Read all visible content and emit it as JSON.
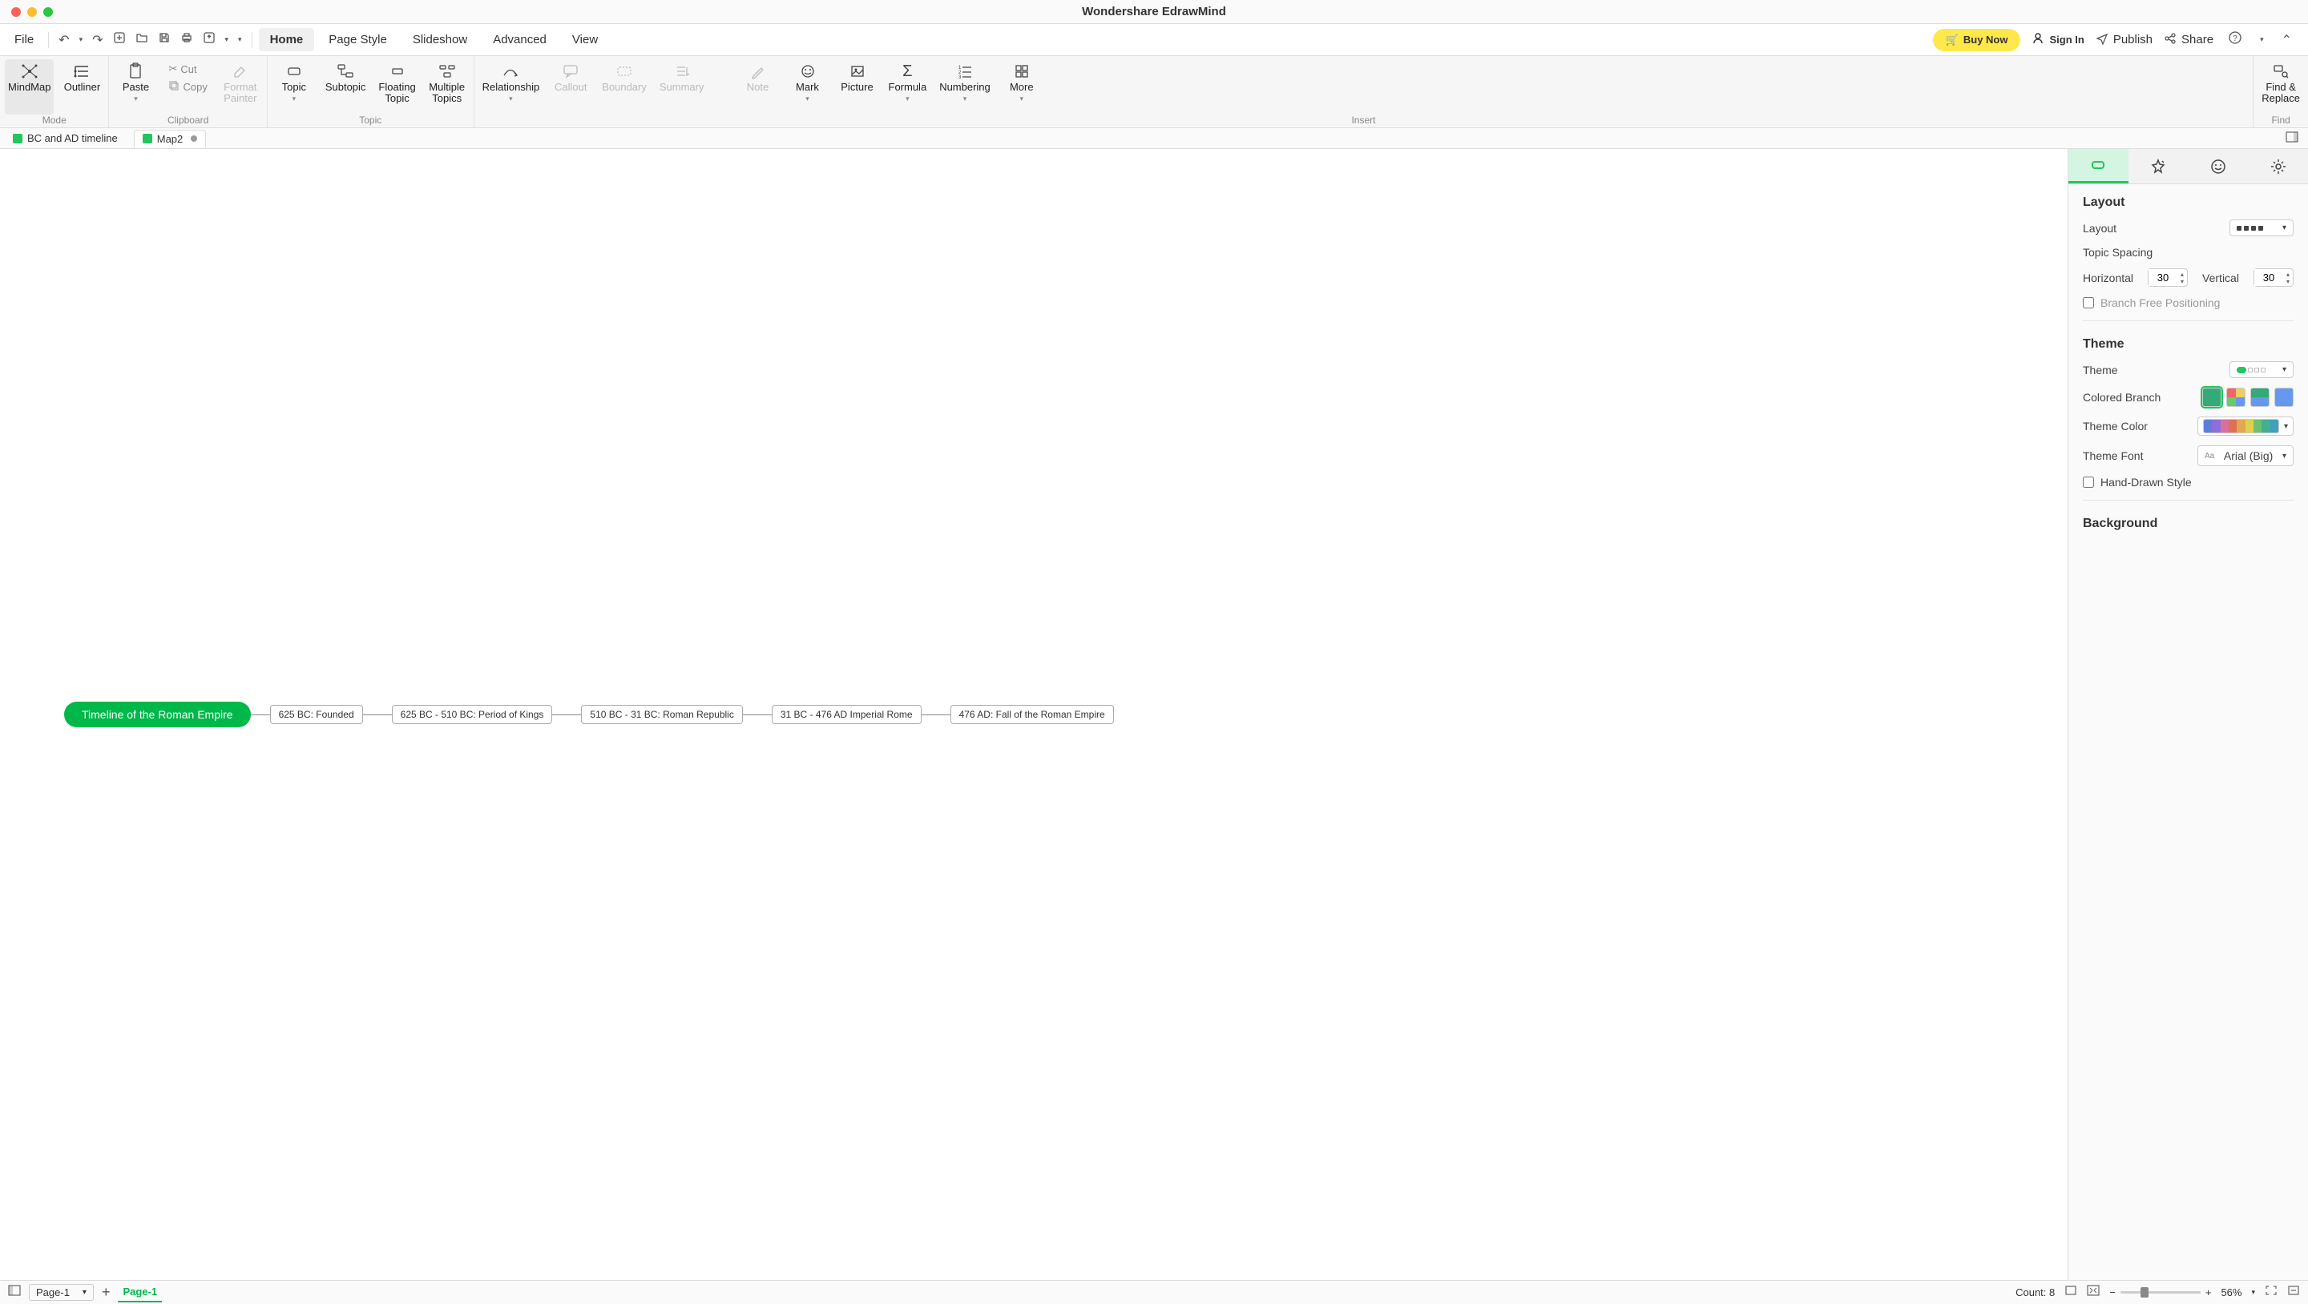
{
  "titlebar": {
    "title": "Wondershare EdrawMind"
  },
  "menubar": {
    "file": "File",
    "tabs": [
      "Home",
      "Page Style",
      "Slideshow",
      "Advanced",
      "View"
    ],
    "active_tab": 0,
    "buy_now": "Buy Now",
    "sign_in": "Sign In",
    "publish": "Publish",
    "share": "Share"
  },
  "ribbon": {
    "mode": {
      "mindmap": "MindMap",
      "outliner": "Outliner",
      "label": "Mode"
    },
    "clipboard": {
      "paste": "Paste",
      "cut": "Cut",
      "copy": "Copy",
      "format_painter": "Format\nPainter",
      "label": "Clipboard"
    },
    "topic": {
      "topic": "Topic",
      "subtopic": "Subtopic",
      "floating": "Floating\nTopic",
      "multiple": "Multiple\nTopics",
      "label": "Topic"
    },
    "insert": {
      "relationship": "Relationship",
      "callout": "Callout",
      "boundary": "Boundary",
      "summary": "Summary",
      "note": "Note",
      "mark": "Mark",
      "picture": "Picture",
      "formula": "Formula",
      "numbering": "Numbering",
      "more": "More",
      "label": "Insert"
    },
    "find": {
      "find_replace": "Find &\nReplace",
      "label": "Find"
    }
  },
  "doc_tabs": {
    "tabs": [
      {
        "label": "BC and AD timeline",
        "active": false,
        "dirty": false
      },
      {
        "label": "Map2",
        "active": true,
        "dirty": true
      }
    ]
  },
  "timeline": {
    "root": "Timeline of the Roman Empire",
    "nodes": [
      "625 BC: Founded",
      "625 BC - 510 BC: Period of Kings",
      "510 BC - 31 BC: Roman Republic",
      "31 BC - 476 AD Imperial Rome",
      "476 AD: Fall of the Roman Empire"
    ]
  },
  "sidebar": {
    "layout": {
      "title": "Layout",
      "layout_label": "Layout",
      "spacing_label": "Topic Spacing",
      "horizontal_label": "Horizontal",
      "horizontal_value": "30",
      "vertical_label": "Vertical",
      "vertical_value": "30",
      "branch_free": "Branch Free Positioning"
    },
    "theme": {
      "title": "Theme",
      "theme_label": "Theme",
      "colored_branch": "Colored Branch",
      "theme_color": "Theme Color",
      "theme_font": "Theme Font",
      "font_value": "Arial (Big)",
      "hand_drawn": "Hand-Drawn Style",
      "palette": [
        "#5b7fd9",
        "#8c6fd9",
        "#d96f9f",
        "#e07050",
        "#e0a850",
        "#e0d050",
        "#70c070",
        "#40b090",
        "#40a0c0"
      ]
    },
    "background": {
      "title": "Background"
    }
  },
  "statusbar": {
    "page_select": "Page-1",
    "page_tab": "Page-1",
    "count": "Count: 8",
    "zoom": "56%"
  }
}
